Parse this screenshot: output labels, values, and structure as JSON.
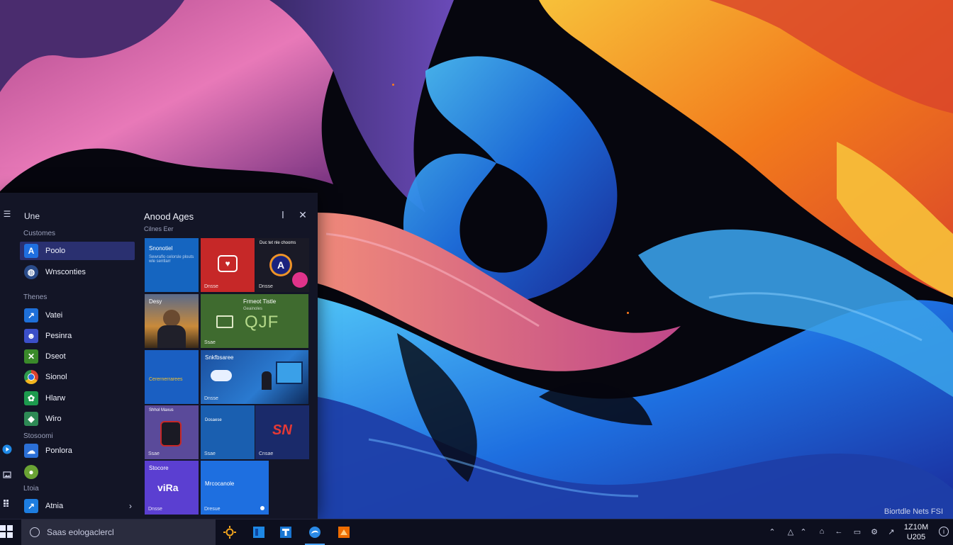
{
  "wallpaper": {
    "watermark": "Biortdle Nets FSI"
  },
  "start_menu": {
    "list_title": "Une",
    "groups": [
      {
        "label": "Customes",
        "items": [
          {
            "label": "Poolo",
            "icon": "a-letter-icon",
            "color": "#1f6fe0",
            "selected": true
          },
          {
            "label": "Wnsconties",
            "icon": "globe-icon",
            "color": "#2b4c8a",
            "selected": false
          }
        ]
      },
      {
        "label": "Thenes",
        "items": [
          {
            "label": "Vatei",
            "icon": "arrow-tile-icon",
            "color": "#1e6fd8",
            "selected": false
          },
          {
            "label": "Pesinra",
            "icon": "people-icon",
            "color": "#3b4fc8",
            "selected": false
          },
          {
            "label": "Dseot",
            "icon": "xbox-icon",
            "color": "#3a8a2a",
            "selected": false
          },
          {
            "label": "Sionol",
            "icon": "chrome-icon",
            "color": "#d9432f",
            "selected": false
          },
          {
            "label": "Hlarw",
            "icon": "plant-icon",
            "color": "#1d9a4e",
            "selected": false
          },
          {
            "label": "Wiro",
            "icon": "map-icon",
            "color": "#2e8a55",
            "selected": false
          }
        ]
      },
      {
        "label": "Stosoomi",
        "items": [
          {
            "label": "Ponlora",
            "icon": "cloud-icon",
            "color": "#2b6fd6",
            "selected": false
          },
          {
            "label": "",
            "icon": "ball-icon",
            "color": "#6aa334",
            "selected": false
          }
        ]
      },
      {
        "label": "Ltoia",
        "items": [
          {
            "label": "Atnia",
            "icon": "store-icon",
            "color": "#1d7de0",
            "selected": false
          }
        ]
      }
    ],
    "tiles_pane": {
      "title": "Anood Ages",
      "subtitle": "Cilnes Eer",
      "tiles": [
        {
          "title": "Snonotiel",
          "sub": "Sewraflo celorsle plouts wle sentlarr",
          "label": "",
          "bg": "#1565c0",
          "art": "text"
        },
        {
          "title": "",
          "sub": "",
          "label": "Dnsse",
          "bg": "#c62828",
          "art": "red-app-icon"
        },
        {
          "title": "Duc tet nle chooms",
          "sub": "",
          "label": "Dnsse",
          "bg": "#1a1a26",
          "art": "a-circle-icon"
        },
        {
          "title": "Desy",
          "sub": "",
          "label": "",
          "bg": "#3b3524",
          "art": "photo-person"
        },
        {
          "title": "Frmeot Tistle",
          "sub": "Geainoles",
          "label": "Ssae",
          "bg": "#3f6b2f",
          "art": "qjf-text",
          "big": "QJF"
        },
        {
          "title": "Cerernerrarees",
          "sub": "",
          "label": "",
          "bg": "#1a5fc2",
          "art": "yellow-text"
        },
        {
          "title": "Snkfbsaree",
          "sub": "",
          "label": "Dnsse",
          "bg": "#1b4f9e",
          "art": "photo-desk"
        },
        {
          "title": "Shhol Maxus",
          "sub": "",
          "label": "Ssae",
          "bg": "#5a4a9a",
          "art": "photo-robot"
        },
        {
          "title": "Dosaese",
          "sub": "",
          "label": "Ssae",
          "bg": "#1a5fb0",
          "art": "plain"
        },
        {
          "title": "",
          "sub": "",
          "label": "Cnsae",
          "bg": "#1a2a6a",
          "art": "sn-logo",
          "big": "SN"
        },
        {
          "title": "Stocore",
          "sub": "",
          "label": "Dnsse",
          "bg": "#5b3fd1",
          "art": "vi-logo",
          "big": "viRa"
        },
        {
          "title": "Mrcocanole",
          "sub": "",
          "label": "Dresue",
          "bg": "#1e6fe0",
          "art": "plain"
        }
      ]
    }
  },
  "taskbar": {
    "search_placeholder": "Saas eologaclercl",
    "apps": [
      {
        "name": "sun-app-icon",
        "color": "#f2a51e",
        "active": false
      },
      {
        "name": "blue-square-app-icon",
        "color": "#1e88e5",
        "active": false
      },
      {
        "name": "blue-t-app-icon",
        "color": "#1976d2",
        "active": false
      },
      {
        "name": "edge-app-icon",
        "color": "#2b8ae6",
        "active": true
      },
      {
        "name": "orange-app-icon",
        "color": "#ef6c00",
        "active": false
      }
    ],
    "clock": {
      "time": "1Z10M",
      "date": "U205"
    }
  }
}
